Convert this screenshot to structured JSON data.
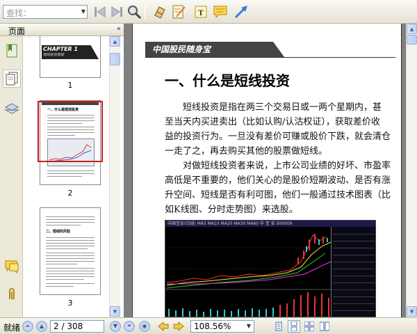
{
  "toolbar": {
    "search_placeholder": "查找：",
    "icons": [
      "first-page-icon",
      "last-page-icon",
      "find-icon",
      "hand-icon",
      "edit-note-icon",
      "text-box-icon",
      "comment-icon",
      "arrow-icon"
    ]
  },
  "left_panel": {
    "title": "页面",
    "collapse_glyph": "«",
    "rail_icons": [
      "bookmark-icon",
      "pages-icon",
      "layers-icon",
      "comments-icon",
      "attachment-icon"
    ],
    "thumbnails": [
      {
        "label": "1",
        "chapter_text": "CHAPTER 1",
        "chapter_sub": "短线投资基础"
      },
      {
        "label": "2",
        "heading_text": "一、什么是短线投资"
      },
      {
        "label": "3",
        "heading_text": "二、短线的风险"
      }
    ]
  },
  "document": {
    "running_head": "中国股民随身宝",
    "section_title": "一、什么是短线投资",
    "paragraph1": [
      "短线投资是指在两三个交易日或一两个星期内，甚",
      "至当天内买进卖出（比如认购/认沽权证），获取差价收",
      "益的投资行为。一旦没有差价可赚或股价下跌，就会清仓",
      "一走了之，再去购买其他的股票做短线。"
    ],
    "paragraph2": [
      "对做短线投资者来说，上市公司业绩的好坏、市盈率",
      "高低是不重要的，他们关心的是股价短期波动、是否有涨",
      "升空间、短线是否有利可图，他们一般通过技术图表（比",
      "如K线图、分时走势图）来选股。"
    ],
    "chart_header": "中国宝安(日线) MA5 MA10 MA20 MA30 MA60   中 宝 安 000009"
  },
  "statusbar": {
    "status": "就绪",
    "current_page": "2",
    "page_separator": "/",
    "total_pages": "308",
    "zoom": "108.56%"
  },
  "colors": {
    "chrome": "#ece9d8",
    "doc_background": "#808080",
    "thumb_highlight": "#cc0000",
    "scroll_blue": "#c2d4f5"
  }
}
